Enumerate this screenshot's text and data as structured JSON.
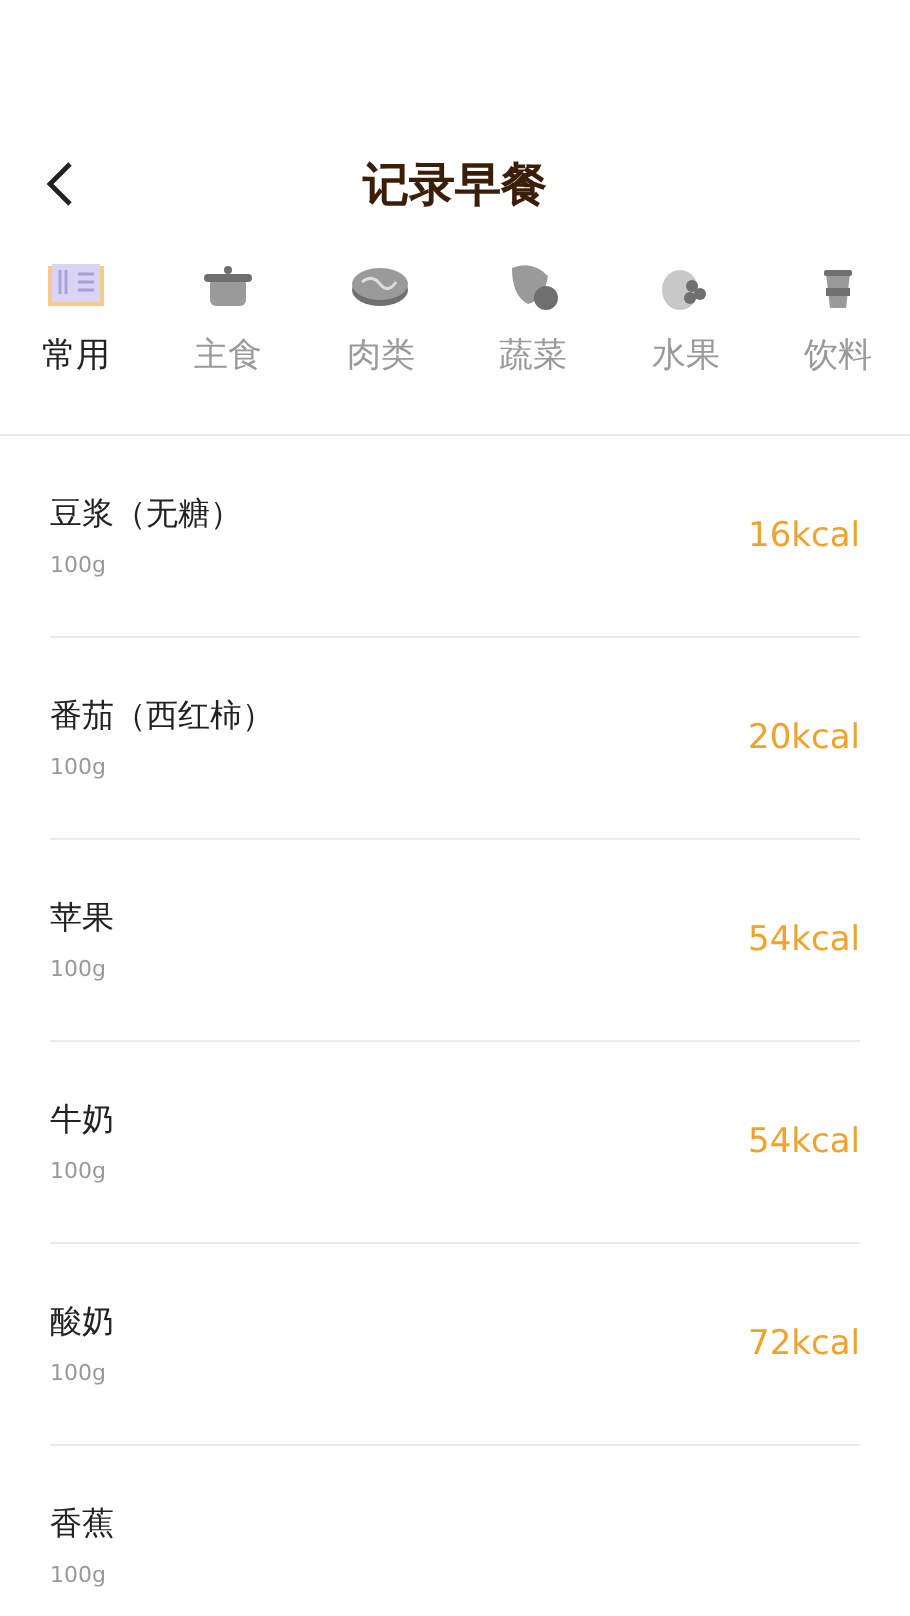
{
  "header": {
    "title": "记录早餐"
  },
  "categories": [
    {
      "label": "常用",
      "kind": "book",
      "selected": true
    },
    {
      "label": "主食",
      "kind": "pot",
      "selected": false
    },
    {
      "label": "肉类",
      "kind": "meat",
      "selected": false
    },
    {
      "label": "蔬菜",
      "kind": "vegetable",
      "selected": false
    },
    {
      "label": "水果",
      "kind": "fruit",
      "selected": false
    },
    {
      "label": "饮料",
      "kind": "drink",
      "selected": false
    }
  ],
  "foods": [
    {
      "name": "豆浆（无糖）",
      "amount": "100g",
      "calories": "16kcal"
    },
    {
      "name": "番茄（西红柿）",
      "amount": "100g",
      "calories": "20kcal"
    },
    {
      "name": "苹果",
      "amount": "100g",
      "calories": "54kcal"
    },
    {
      "name": "牛奶",
      "amount": "100g",
      "calories": "54kcal"
    },
    {
      "name": "酸奶",
      "amount": "100g",
      "calories": "72kcal"
    },
    {
      "name": "香蕉",
      "amount": "100g"
    }
  ]
}
